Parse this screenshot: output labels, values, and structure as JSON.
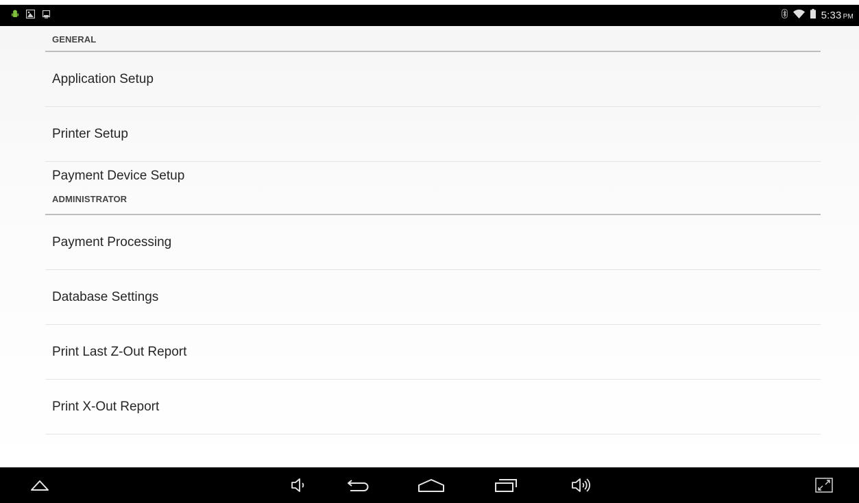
{
  "status_bar": {
    "left_icons": [
      "android-notification-icon",
      "image-notification-icon",
      "screen-notification-icon"
    ],
    "right_icons": [
      "bluetooth-icon",
      "wifi-icon",
      "battery-icon"
    ],
    "time": "5:33",
    "ampm": "PM"
  },
  "settings": {
    "sections": [
      {
        "header": "GENERAL",
        "items": [
          "Application Setup",
          "Printer Setup",
          "Payment Device Setup"
        ]
      },
      {
        "header": "ADMINISTRATOR",
        "items": [
          "Payment Processing",
          "Database Settings",
          "Print Last Z-Out Report",
          "Print X-Out Report"
        ]
      }
    ]
  },
  "nav_bar": {
    "buttons": [
      "hide-bar-icon",
      "volume-down-icon",
      "back-icon",
      "home-icon",
      "recent-apps-icon",
      "volume-up-icon",
      "fullscreen-icon"
    ]
  },
  "colors": {
    "bar_background": "#000000",
    "divider": "#bdbdbd",
    "item_text": "#262626"
  }
}
